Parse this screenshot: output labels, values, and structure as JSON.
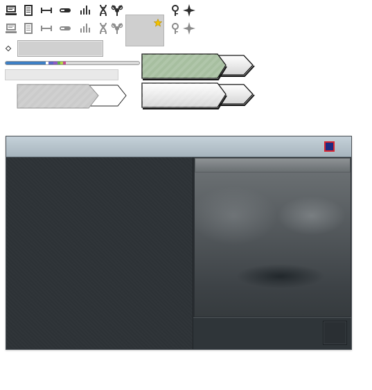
{
  "toolbar_icons": {
    "row1": [
      "computer-icon",
      "document-icon",
      "range-icon",
      "toggle-icon",
      "bar-chart-icon",
      "dna-icon",
      "bio-symbol-icon"
    ],
    "row2": [
      "computer-icon",
      "document-icon",
      "range-icon",
      "toggle-icon",
      "bar-chart-icon",
      "dna-icon",
      "bio-symbol-icon"
    ],
    "extra": [
      "pin-icon",
      "sparkle-icon"
    ]
  },
  "slot": {
    "badge_icon": "star-icon",
    "badge_color": "#f2c200"
  },
  "stat_bar": {
    "segments": [
      {
        "color": "#3d7fc4",
        "fraction": 0.3
      },
      {
        "color": "#ffffff",
        "fraction": 0.02
      },
      {
        "color": "#5a67c8",
        "fraction": 0.04
      },
      {
        "color": "#8c5bc4",
        "fraction": 0.03
      },
      {
        "color": "#5fb04a",
        "fraction": 0.02
      },
      {
        "color": "#b4d64a",
        "fraction": 0.02
      },
      {
        "color": "#c64a8e",
        "fraction": 0.02
      }
    ]
  },
  "buttons": {
    "green_color": "#a7bfa0",
    "gray_color": "#cbcbcb",
    "light_color": "#e9e9e9"
  },
  "window": {
    "close_icon": "close-icon",
    "colors": {
      "titlebar": "#b6c3cb",
      "body": "#2d3236",
      "close_fill": "#1e2a80",
      "close_border": "#d8232f"
    }
  }
}
